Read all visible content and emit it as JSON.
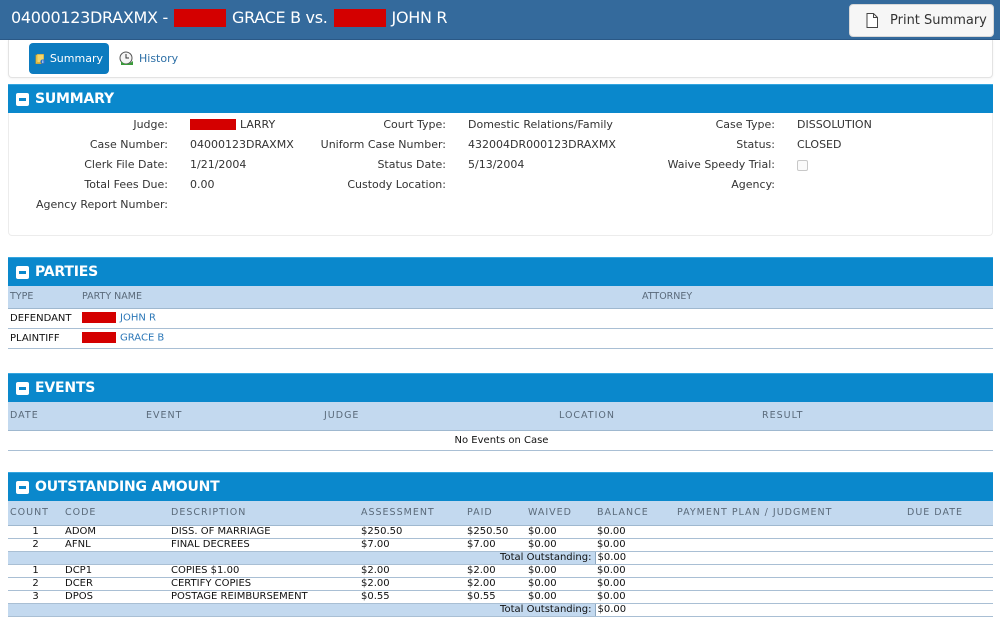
{
  "header": {
    "case_id": "04000123DRAXMX -",
    "plaintiff_short": "GRACE B vs.",
    "defendant_short": "JOHN R",
    "print_button": "Print Summary"
  },
  "tabs": [
    {
      "label": "Summary",
      "icon": "folder-info-icon",
      "active": true
    },
    {
      "label": "History",
      "icon": "history-clock-icon",
      "active": false
    }
  ],
  "colors": {
    "topbar": "#346a9c",
    "panel_header": "#0a88cc",
    "table_header": "#c3d9ef",
    "redaction": "#d40000",
    "link": "#2d78b8"
  },
  "summary": {
    "title": "SUMMARY",
    "col1": [
      {
        "label": "Judge:",
        "value": "LARRY",
        "redacted_prefix": true
      },
      {
        "label": "Case Number:",
        "value": "04000123DRAXMX"
      },
      {
        "label": "Clerk File Date:",
        "value": "1/21/2004"
      },
      {
        "label": "Total Fees Due:",
        "value": "0.00"
      },
      {
        "label": "Agency Report Number:",
        "value": ""
      }
    ],
    "col2": [
      {
        "label": "Court Type:",
        "value": "Domestic Relations/Family"
      },
      {
        "label": "Uniform Case Number:",
        "value": "432004DR000123DRAXMX"
      },
      {
        "label": "Status Date:",
        "value": "5/13/2004"
      },
      {
        "label": "Custody Location:",
        "value": ""
      }
    ],
    "col3": [
      {
        "label": "Case Type:",
        "value": "DISSOLUTION"
      },
      {
        "label": "Status:",
        "value": "CLOSED"
      },
      {
        "label": "Waive Speedy Trial:",
        "checkbox": true,
        "checked": false
      },
      {
        "label": "Agency:",
        "value": ""
      }
    ]
  },
  "parties": {
    "title": "PARTIES",
    "columns": [
      "TYPE",
      "PARTY NAME",
      "ATTORNEY"
    ],
    "rows": [
      {
        "type": "DEFENDANT",
        "name": "JOHN R",
        "attorney": ""
      },
      {
        "type": "PLAINTIFF",
        "name": "GRACE B",
        "attorney": ""
      }
    ]
  },
  "events": {
    "title": "EVENTS",
    "columns": [
      "DATE",
      "EVENT",
      "JUDGE",
      "LOCATION",
      "RESULT"
    ],
    "empty_message": "No Events on Case"
  },
  "outstanding": {
    "title": "OUTSTANDING AMOUNT",
    "columns": [
      "COUNT",
      "CODE",
      "DESCRIPTION",
      "ASSESSMENT",
      "PAID",
      "WAIVED",
      "BALANCE",
      "PAYMENT PLAN / JUDGMENT",
      "DUE DATE"
    ],
    "groups": [
      {
        "rows": [
          {
            "count": "1",
            "code": "ADOM",
            "description": "DISS. OF MARRIAGE",
            "assessment": "$250.50",
            "paid": "$250.50",
            "waived": "$0.00",
            "balance": "$0.00",
            "plan": "",
            "due": ""
          },
          {
            "count": "2",
            "code": "AFNL",
            "description": "FINAL DECREES",
            "assessment": "$7.00",
            "paid": "$7.00",
            "waived": "$0.00",
            "balance": "$0.00",
            "plan": "",
            "due": ""
          }
        ],
        "total_label": "Total Outstanding:",
        "total_value": "$0.00"
      },
      {
        "rows": [
          {
            "count": "1",
            "code": "DCP1",
            "description": "COPIES $1.00",
            "assessment": "$2.00",
            "paid": "$2.00",
            "waived": "$0.00",
            "balance": "$0.00",
            "plan": "",
            "due": ""
          },
          {
            "count": "2",
            "code": "DCER",
            "description": "CERTIFY COPIES",
            "assessment": "$2.00",
            "paid": "$2.00",
            "waived": "$0.00",
            "balance": "$0.00",
            "plan": "",
            "due": ""
          },
          {
            "count": "3",
            "code": "DPOS",
            "description": "POSTAGE REIMBURSEMENT",
            "assessment": "$0.55",
            "paid": "$0.55",
            "waived": "$0.00",
            "balance": "$0.00",
            "plan": "",
            "due": ""
          }
        ],
        "total_label": "Total Outstanding:",
        "total_value": "$0.00"
      }
    ]
  }
}
